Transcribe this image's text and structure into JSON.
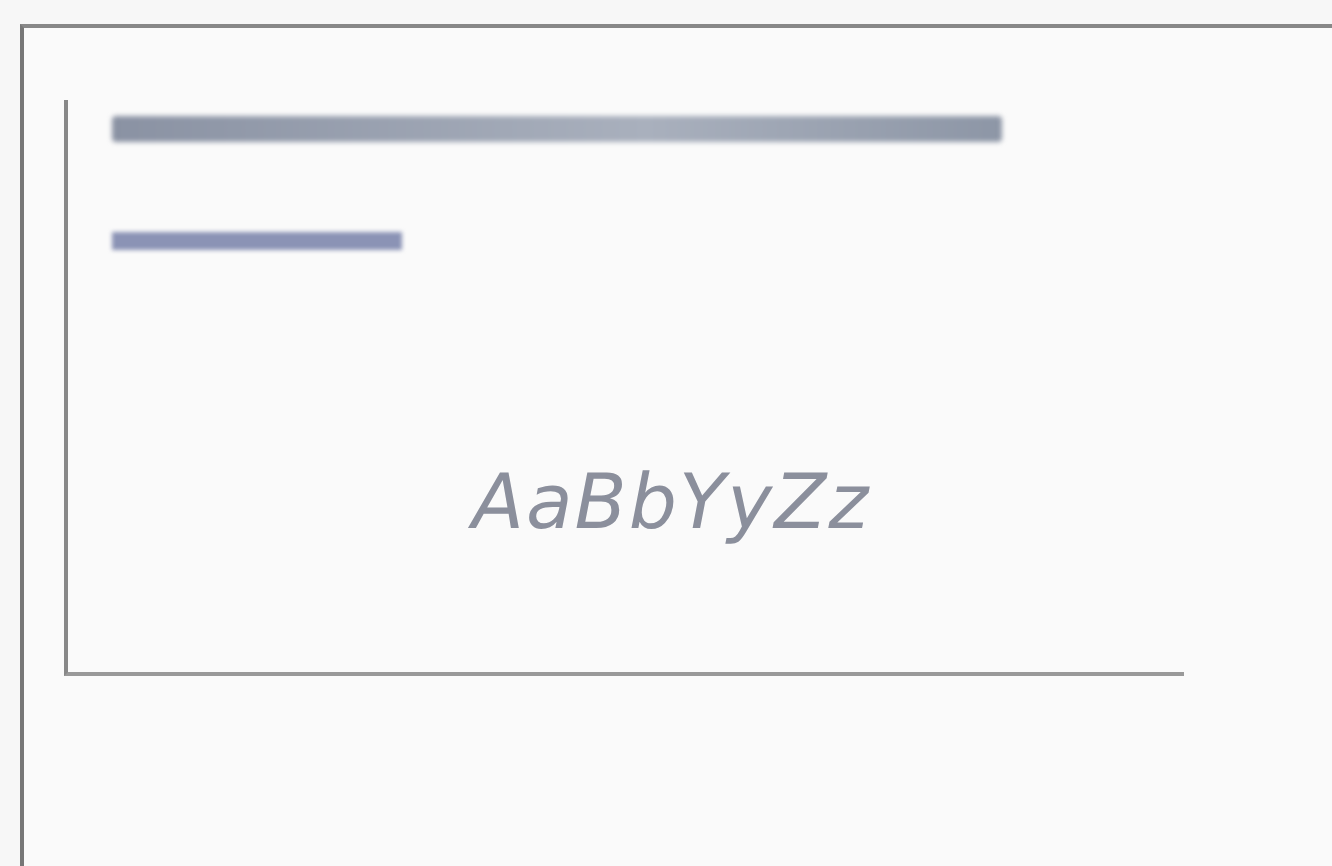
{
  "preview": {
    "sample_text": "AaBbYyZz"
  }
}
